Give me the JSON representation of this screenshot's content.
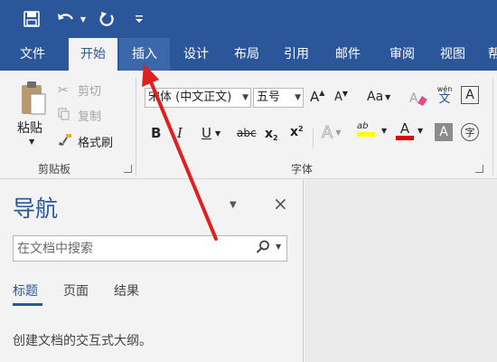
{
  "quick_access": {
    "icons": [
      "save-icon",
      "undo-icon",
      "redo-icon",
      "customize-icon"
    ]
  },
  "tabs": [
    "文件",
    "开始",
    "插入",
    "设计",
    "布局",
    "引用",
    "邮件",
    "审阅",
    "视图",
    "帮"
  ],
  "active_tab": "开始",
  "hovered_tab": "插入",
  "clipboard": {
    "paste": "粘贴",
    "cut": "剪切",
    "copy": "复制",
    "format_painter": "格式刷",
    "group_label": "剪贴板"
  },
  "font": {
    "family": "宋体 (中文正文)",
    "size": "五号",
    "grow": "A",
    "shrink": "A",
    "case": "Aa",
    "bold": "B",
    "italic": "I",
    "underline": "U",
    "strikethrough": "abc",
    "subscript": "x",
    "subscript_mark": "2",
    "superscript": "x",
    "superscript_mark": "2",
    "text_effects": "A",
    "highlight": "ab",
    "font_color": "A",
    "shading": "A",
    "phonetic_top": "wén",
    "phonetic_bottom": "文",
    "border": "A",
    "enclose": "字",
    "group_label": "字体"
  },
  "nav_pane": {
    "title": "导航",
    "close": "×",
    "search_placeholder": "在文档中搜索",
    "tabs": [
      "标题",
      "页面",
      "结果"
    ],
    "hint": "创建文档的交互式大纲。"
  },
  "colors": {
    "brand": "#2b579a",
    "highlight": "#ffff00",
    "font_color": "#e00000",
    "annotation_arrow": "#e02020"
  }
}
